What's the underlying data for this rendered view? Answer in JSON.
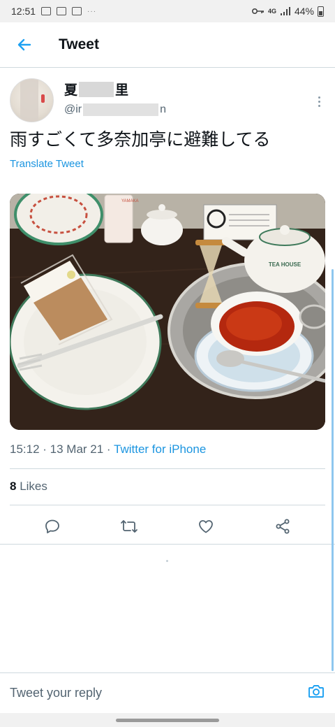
{
  "status_bar": {
    "time": "12:51",
    "battery": "44%",
    "network": "4G",
    "more": "···"
  },
  "header": {
    "title": "Tweet",
    "back_icon": "arrow-left-icon"
  },
  "tweet": {
    "author": {
      "name_start": "夏",
      "name_end": "里",
      "handle_start": "@ir",
      "handle_end": "n"
    },
    "text": "雨すごくて多奈加亭に避難してる",
    "translate_label": "Translate Tweet",
    "photo_labels": {
      "pot": "TEA HOUSE",
      "cup_sign": "YAMAKA"
    },
    "time": "15:12",
    "date": "13 Mar 21",
    "separator": " · ",
    "client": "Twitter for iPhone",
    "likes_count": "8",
    "likes_label": " Likes"
  },
  "actions": [
    "reply-icon",
    "retweet-icon",
    "like-icon",
    "share-icon"
  ],
  "reply_bar": {
    "placeholder": "Tweet your reply",
    "camera_icon": "camera-icon"
  },
  "colors": {
    "accent": "#1da1f2",
    "link": "#1b95e0",
    "secondary_text": "#536471",
    "divider": "#cfd9de"
  }
}
